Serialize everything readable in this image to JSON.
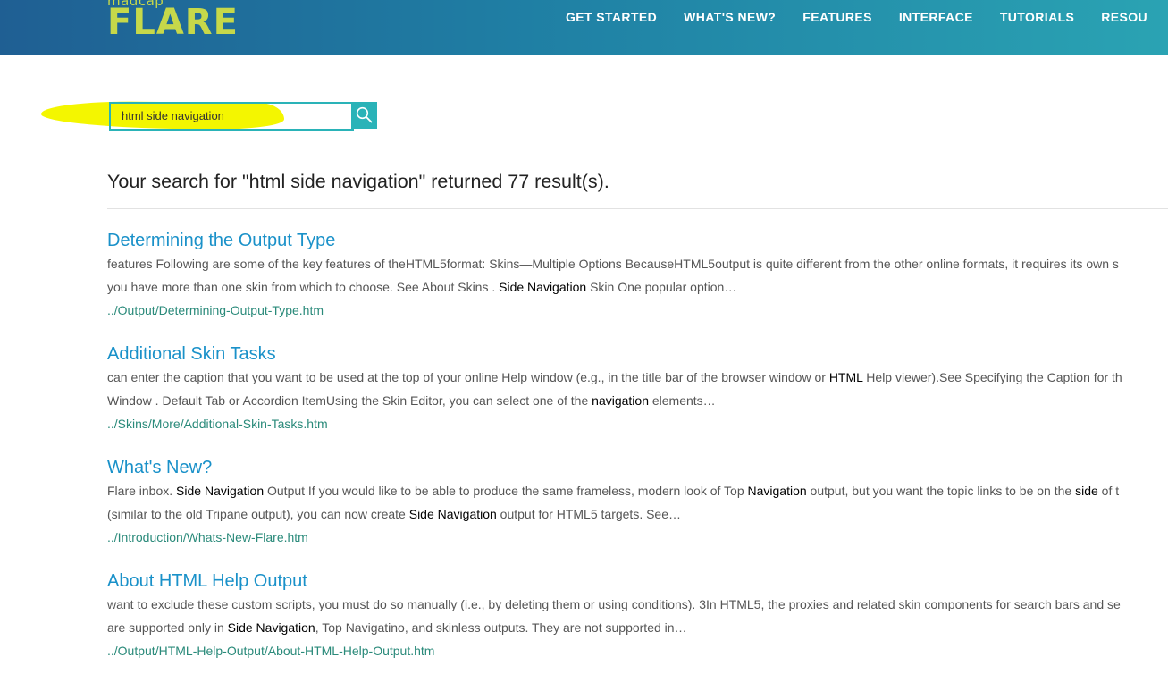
{
  "header": {
    "logo_small": "madcap",
    "logo_big": "FLARE",
    "nav": [
      "GET STARTED",
      "WHAT'S NEW?",
      "FEATURES",
      "INTERFACE",
      "TUTORIALS",
      "RESOU"
    ]
  },
  "search": {
    "value": "html side navigation",
    "button_icon": "search-icon",
    "highlight_color": "#f4f600",
    "accent_color": "#2ab3b8"
  },
  "summary": "Your search for \"html side navigation\" returned 77 result(s).",
  "results": [
    {
      "title": "Determining the Output Type",
      "line1": [
        {
          "t": "features Following are some of the key features of theHTML5format: Skins—Multiple Options BecauseHTML5output is quite different from the other online formats, it requires its own s",
          "h": false
        }
      ],
      "line2": [
        {
          "t": "you have more than one skin from which to choose. See About Skins . ",
          "h": false
        },
        {
          "t": "Side Navigation",
          "h": true
        },
        {
          "t": " Skin One popular option…",
          "h": false
        }
      ],
      "url": "../Output/Determining-Output-Type.htm"
    },
    {
      "title": "Additional Skin Tasks",
      "line1": [
        {
          "t": "can enter the caption that you want to be used at the top of your online Help window (e.g., in the title bar of the browser window or ",
          "h": false
        },
        {
          "t": "HTML",
          "h": true
        },
        {
          "t": " Help viewer).See Specifying the Caption for th",
          "h": false
        }
      ],
      "line2": [
        {
          "t": "Window . Default Tab or Accordion ItemUsing the Skin Editor, you can select one of the ",
          "h": false
        },
        {
          "t": "navigation",
          "h": true
        },
        {
          "t": " elements…",
          "h": false
        }
      ],
      "url": "../Skins/More/Additional-Skin-Tasks.htm"
    },
    {
      "title": "What's New?",
      "line1": [
        {
          "t": "Flare inbox. ",
          "h": false
        },
        {
          "t": "Side Navigation",
          "h": true
        },
        {
          "t": " Output If you would like to be able to produce the same frameless, modern look of Top ",
          "h": false
        },
        {
          "t": "Navigation",
          "h": true
        },
        {
          "t": " output, but you want the topic links to be on the ",
          "h": false
        },
        {
          "t": "side",
          "h": true
        },
        {
          "t": " of t",
          "h": false
        }
      ],
      "line2": [
        {
          "t": "(similar to the old Tripane output), you can now create ",
          "h": false
        },
        {
          "t": "Side Navigation",
          "h": true
        },
        {
          "t": " output for HTML5 targets. See…",
          "h": false
        }
      ],
      "url": "../Introduction/Whats-New-Flare.htm"
    },
    {
      "title": "About HTML Help Output",
      "line1": [
        {
          "t": "want to exclude these custom scripts, you must do so manually (i.e., by deleting them or using conditions). 3In HTML5, the proxies and related skin components for search bars and se",
          "h": false
        }
      ],
      "line2": [
        {
          "t": "are supported only in ",
          "h": false
        },
        {
          "t": "Side Navigation",
          "h": true
        },
        {
          "t": ", Top Navigatino, and skinless outputs. They are not supported in…",
          "h": false
        }
      ],
      "url": "../Output/HTML-Help-Output/About-HTML-Help-Output.htm"
    }
  ]
}
